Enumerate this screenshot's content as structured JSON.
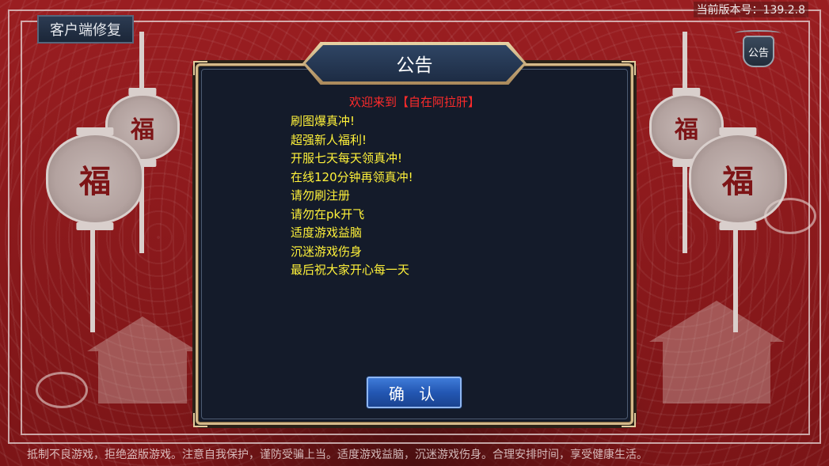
{
  "top_bar": {
    "client_repair_label": "客户端修复",
    "version_text": "当前版本号：139.2.8",
    "notice_icon_label": "公告"
  },
  "dialog": {
    "title": "公告",
    "welcome": "欢迎来到【自在阿拉肝】",
    "lines": [
      "刷图爆真冲!",
      "超强新人福利!",
      "开服七天每天领真冲!",
      "在线120分钟再领真冲!",
      "请勿刷注册",
      "请勿在pk开飞",
      "适度游戏益脑",
      "沉迷游戏伤身",
      "最后祝大家开心每一天"
    ],
    "confirm_label": "确 认"
  },
  "background": {
    "lantern_character": "福"
  },
  "footer": {
    "health_notice": "抵制不良游戏，拒绝盗版游戏。注意自我保护，谨防受骗上当。适度游戏益脑，沉迷游戏伤身。合理安排时间，享受健康生活。"
  },
  "colors": {
    "welcome_text": "#ff2b2b",
    "body_text": "#fff23a",
    "panel_bg": "#141b2a",
    "confirm_button": "#2357b3",
    "background": "#8c1a1c"
  }
}
